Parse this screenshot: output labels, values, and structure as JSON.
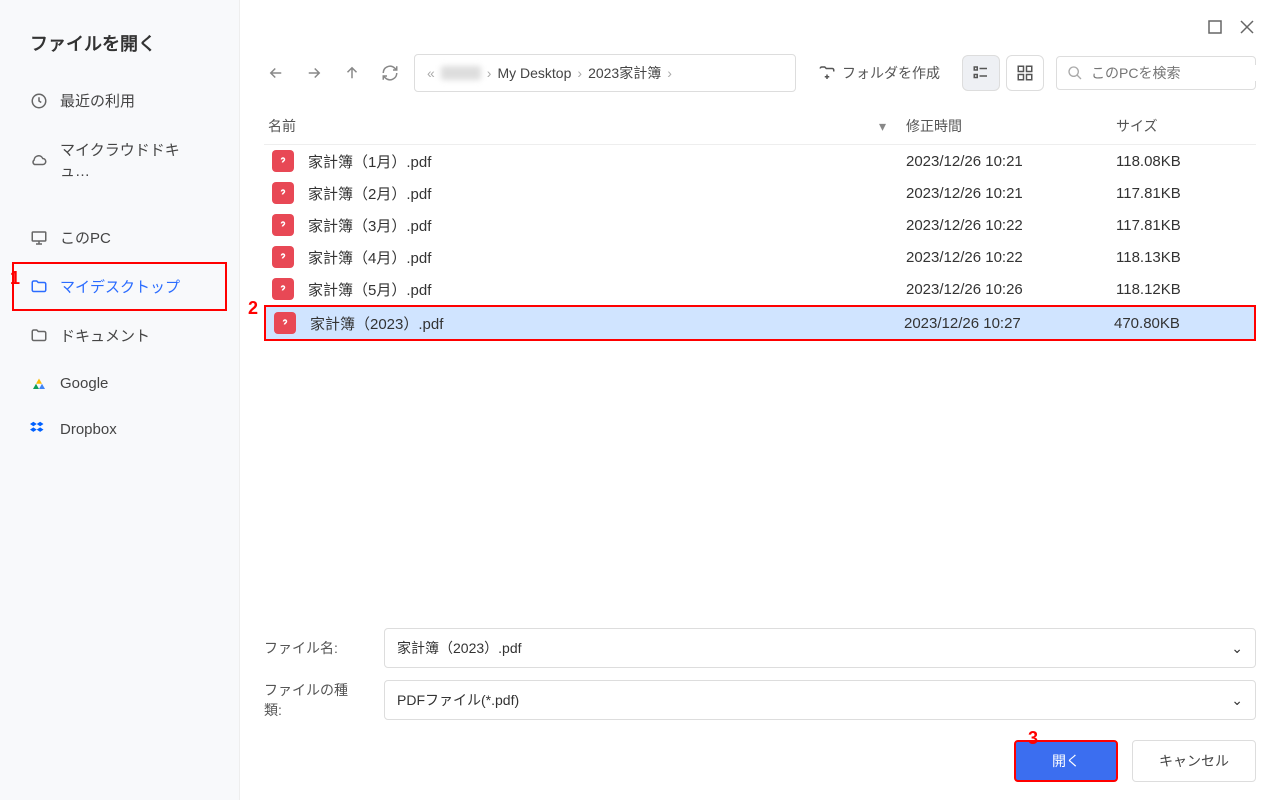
{
  "dialog_title": "ファイルを開く",
  "sidebar": {
    "items": [
      {
        "label": "最近の利用",
        "icon": "clock-icon"
      },
      {
        "label": "マイクラウドドキュ…",
        "icon": "cloud-icon"
      },
      {
        "label": "このPC",
        "icon": "monitor-icon"
      },
      {
        "label": "マイデスクトップ",
        "icon": "folder-icon",
        "selected": true
      },
      {
        "label": "ドキュメント",
        "icon": "folder-icon"
      },
      {
        "label": "Google",
        "icon": "google-icon"
      },
      {
        "label": "Dropbox",
        "icon": "dropbox-icon"
      }
    ]
  },
  "breadcrumb": {
    "segments": [
      "",
      "My Desktop",
      "2023家計簿"
    ]
  },
  "toolbar": {
    "make_folder": "フォルダを作成",
    "search_placeholder": "このPCを検索"
  },
  "columns": {
    "name": "名前",
    "date": "修正時間",
    "size": "サイズ"
  },
  "files": [
    {
      "name": "家計簿（1月）.pdf",
      "date": "2023/12/26 10:21",
      "size": "118.08KB"
    },
    {
      "name": "家計簿（2月）.pdf",
      "date": "2023/12/26 10:21",
      "size": "117.81KB"
    },
    {
      "name": "家計簿（3月）.pdf",
      "date": "2023/12/26 10:22",
      "size": "117.81KB"
    },
    {
      "name": "家計簿（4月）.pdf",
      "date": "2023/12/26 10:22",
      "size": "118.13KB"
    },
    {
      "name": "家計簿（5月）.pdf",
      "date": "2023/12/26 10:26",
      "size": "118.12KB"
    },
    {
      "name": "家計簿（2023）.pdf",
      "date": "2023/12/26 10:27",
      "size": "470.80KB",
      "selected": true
    }
  ],
  "form": {
    "filename_label": "ファイル名:",
    "filename_value": "家計簿（2023）.pdf",
    "filetype_label": "ファイルの種類:",
    "filetype_value": "PDFファイル(*.pdf)"
  },
  "actions": {
    "open": "開く",
    "cancel": "キャンセル"
  },
  "annotations": {
    "one": "1",
    "two": "2",
    "three": "3"
  }
}
